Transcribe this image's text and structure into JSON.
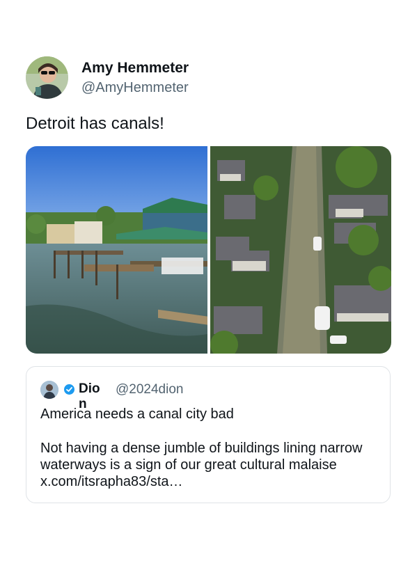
{
  "tweet": {
    "author_name": "Amy Hemmeter",
    "author_handle": "@AmyHemmeter",
    "text": "Detroit has canals!",
    "avatar_icon": "profile-photo"
  },
  "quote": {
    "author_name": "Dio",
    "author_name_overflow": "n",
    "author_handle": "@2024dion",
    "verified_icon": "verified-badge-icon",
    "line1": "America needs a canal city bad",
    "body_lines": [
      "Not having a dense jumble of buildings lining narrow",
      "waterways is a sign of our great cultural malaise",
      "x.com/itsrapha83/sta…"
    ]
  },
  "colors": {
    "text": "#0f1419",
    "secondary_text": "#536471",
    "verified_blue": "#1d9bf0",
    "border": "#dfe3e7"
  }
}
